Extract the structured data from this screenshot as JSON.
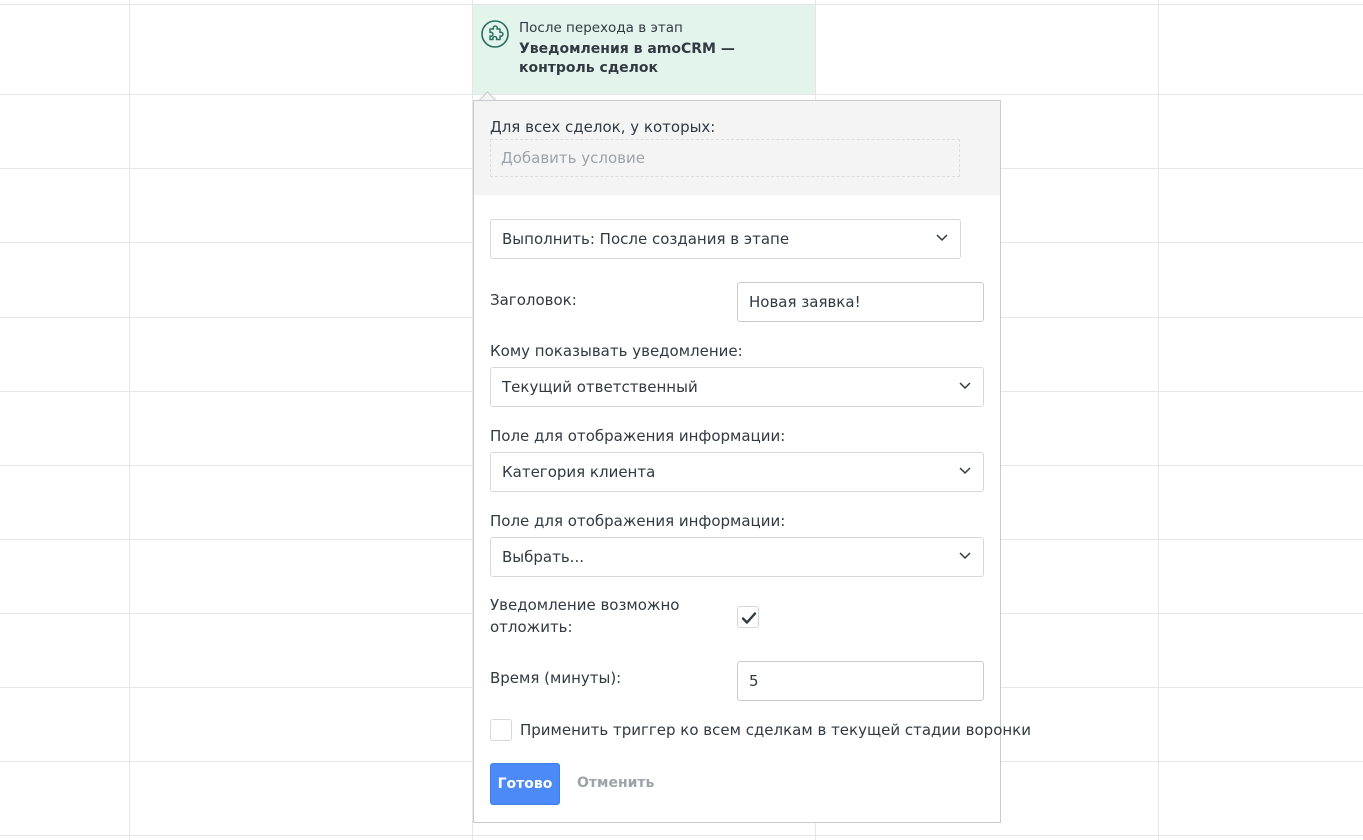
{
  "trigger": {
    "caption": "После перехода в этап",
    "title": "Уведомления в amoCRM — контроль сделок",
    "icon": "puzzle-icon",
    "background": "#e2f4ec"
  },
  "popup": {
    "condition_label": "Для всех сделок, у которых:",
    "condition_placeholder": "Добавить условие",
    "execute_select": "Выполнить: После создания в этапе",
    "title_label": "Заголовок:",
    "title_value": "Новая заявка!",
    "recipients_label": "Кому показывать уведомление:",
    "recipients_value": "Текущий ответственный",
    "info_field_1_label": "Поле для отображения информации:",
    "info_field_1_value": "Категория клиента",
    "info_field_2_label": "Поле для отображения информации:",
    "info_field_2_value": "Выбрать...",
    "postpone_label_line1": "Уведомление возможно",
    "postpone_label_line2": "отложить:",
    "postpone_checked": true,
    "time_label": "Время (минуты):",
    "time_value": "5",
    "apply_all_label": "Применить триггер ко всем сделкам в текущей стадии воронки",
    "apply_all_checked": false,
    "done_button": "Готово",
    "cancel_button": "Отменить"
  },
  "colors": {
    "accent": "#4c8bf7",
    "trigger_bg": "#e2f4ec",
    "icon": "#2a6e5f"
  }
}
